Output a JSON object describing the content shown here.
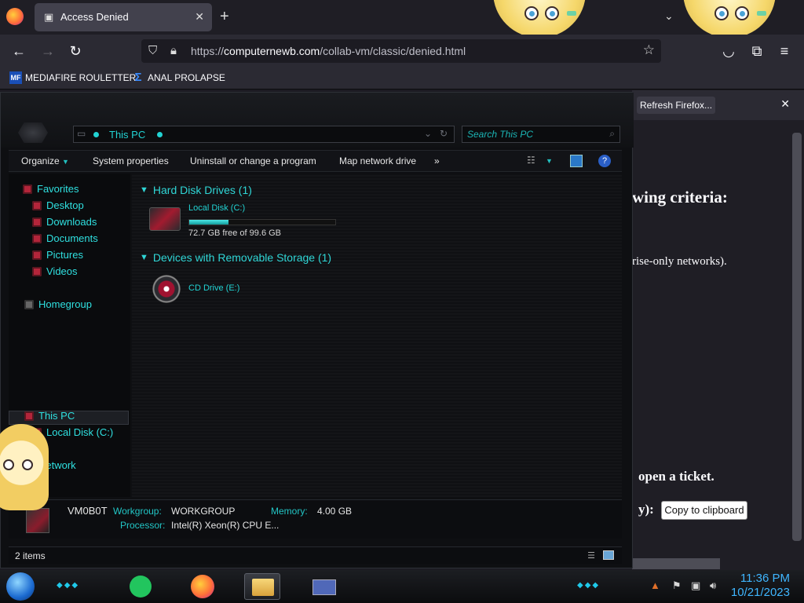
{
  "browser": {
    "tab": {
      "title": "Access Denied"
    },
    "url": {
      "prefix": "https://",
      "host": "computernewb.com",
      "path": "/collab-vm/classic/denied.html"
    },
    "bookmarks": [
      {
        "label": "MEDIAFIRE ROULETTER",
        "icon": "mediafire-icon"
      },
      {
        "label": "ANAL PROLAPSE",
        "icon": "sigma-icon"
      }
    ],
    "notification": {
      "button_label": "Refresh Firefox..."
    }
  },
  "page": {
    "fragments": [
      "wing criteria:",
      "rise-only networks).",
      "open a ticket.",
      "y):"
    ],
    "copy_button": "Copy to clipboard"
  },
  "explorer": {
    "address": "This PC",
    "search_placeholder": "Search This PC",
    "toolbar": [
      "Organize",
      "System properties",
      "Uninstall or change a program",
      "Map network drive",
      "»"
    ],
    "nav": {
      "favorites": "Favorites",
      "favorite_items": [
        "Desktop",
        "Downloads",
        "Documents",
        "Pictures",
        "Videos"
      ],
      "homegroup": "Homegroup",
      "this_pc": "This PC",
      "local_disk": "Local Disk (C:)",
      "network": "Network"
    },
    "groups": {
      "hdd": "Hard Disk Drives (1)",
      "removable": "Devices with Removable Storage (1)"
    },
    "drive_c": {
      "label": "Local Disk (C:)",
      "free": "72.7 GB free of 99.6 GB",
      "used_fraction": 0.27
    },
    "drive_e": {
      "label": "CD Drive (E:)"
    },
    "details": {
      "pc_name": "VM0B0T",
      "workgroup_label": "Workgroup:",
      "workgroup": "WORKGROUP",
      "memory_label": "Memory:",
      "memory": "4.00 GB",
      "processor_label": "Processor:",
      "processor": "Intel(R) Xeon(R) CPU E..."
    },
    "status": "2 items"
  },
  "taskbar": {
    "time": "11:36 PM",
    "date": "10/21/2023"
  }
}
